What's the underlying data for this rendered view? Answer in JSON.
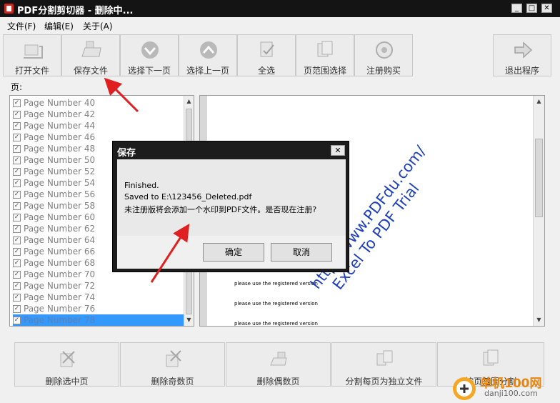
{
  "window": {
    "title": "PDF分割剪切器 - 删除中...",
    "minimize": "_",
    "restore": "□",
    "close": "✕"
  },
  "menu": [
    "文件(F)",
    "编辑(E)",
    "关于(A)"
  ],
  "toolbar": [
    {
      "label": "打开文件",
      "icon": "open-file-icon"
    },
    {
      "label": "保存文件",
      "icon": "save-file-icon"
    },
    {
      "label": "选择下一页",
      "icon": "select-next-page-icon"
    },
    {
      "label": "选择上一页",
      "icon": "select-prev-page-icon"
    },
    {
      "label": "全选",
      "icon": "select-all-icon"
    },
    {
      "label": "页范围选择",
      "icon": "page-range-icon"
    },
    {
      "label": "注册购买",
      "icon": "register-icon"
    },
    {
      "label": "退出程序",
      "icon": "exit-icon"
    }
  ],
  "pages_label": "页:",
  "pages": [
    "Page Number 40",
    "Page Number 42",
    "Page Number 44",
    "Page Number 46",
    "Page Number 48",
    "Page Number 50",
    "Page Number 52",
    "Page Number 54",
    "Page Number 56",
    "Page Number 58",
    "Page Number 60",
    "Page Number 62",
    "Page Number 64",
    "Page Number 66",
    "Page Number 68",
    "Page Number 70",
    "Page Number 72",
    "Page Number 74",
    "Page Number 76",
    "Page Number 78"
  ],
  "selected_page": "Page Number 78",
  "preview": {
    "notice": "please use the registered version",
    "watermark_line1": "http://www.PDFdu.com/",
    "watermark_line2": "Excel To PDF Trial"
  },
  "dialog": {
    "title": "保存",
    "close": "✕",
    "line1": "Finished.",
    "line2": "Saved to E:\\123456_Deleted.pdf",
    "line3": "未注册版将会添加一个水印到PDF文件。是否现在注册?",
    "ok": "确定",
    "cancel": "取消"
  },
  "bottom_buttons": [
    {
      "label": "删除选中页",
      "icon": "delete-selected-icon"
    },
    {
      "label": "删除奇数页",
      "icon": "delete-odd-icon"
    },
    {
      "label": "删除偶数页",
      "icon": "delete-even-icon"
    },
    {
      "label": "分割每页为独立文件",
      "icon": "split-pages-icon"
    },
    {
      "label": "按页范围分割",
      "icon": "split-range-icon"
    }
  ],
  "brand": {
    "name": "单机100网",
    "url": "danji100.com"
  },
  "colors": {
    "titlebar": "#141414",
    "selection": "#3399ff",
    "watermark": "#1f3fbf",
    "arrow": "#e02020"
  }
}
